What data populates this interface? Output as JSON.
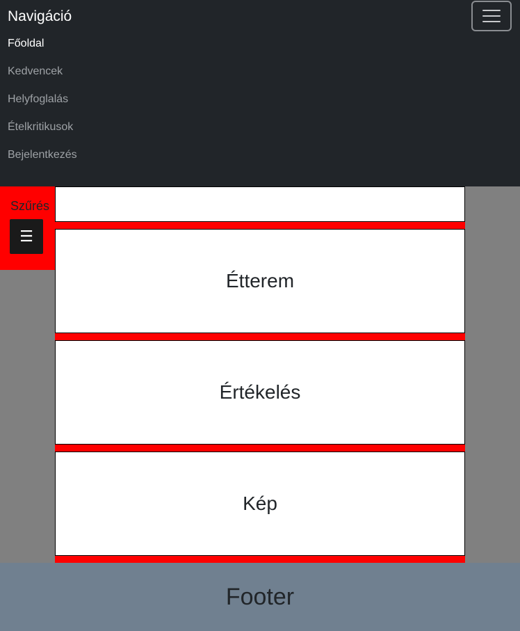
{
  "navbar": {
    "brand": "Navigáció",
    "toggler_icon": "hamburger-icon",
    "links": [
      {
        "label": "Főoldal",
        "active": true
      },
      {
        "label": "Kedvencek",
        "active": false
      },
      {
        "label": "Helyfoglalás",
        "active": false
      },
      {
        "label": "Ételkritikusok",
        "active": false
      },
      {
        "label": "Bejelentkezés",
        "active": false
      }
    ]
  },
  "filter": {
    "label": "Szűrés",
    "button_glyph": "☰",
    "button_icon": "hamburger-icon"
  },
  "cards": [
    {
      "label": ""
    },
    {
      "label": "Étterem"
    },
    {
      "label": "Értékelés"
    },
    {
      "label": "Kép"
    }
  ],
  "footer": {
    "label": "Footer"
  },
  "colors": {
    "navbar_bg": "#212529",
    "accent_red": "#ff0000",
    "page_bg": "#808080",
    "footer_bg": "#708090"
  }
}
